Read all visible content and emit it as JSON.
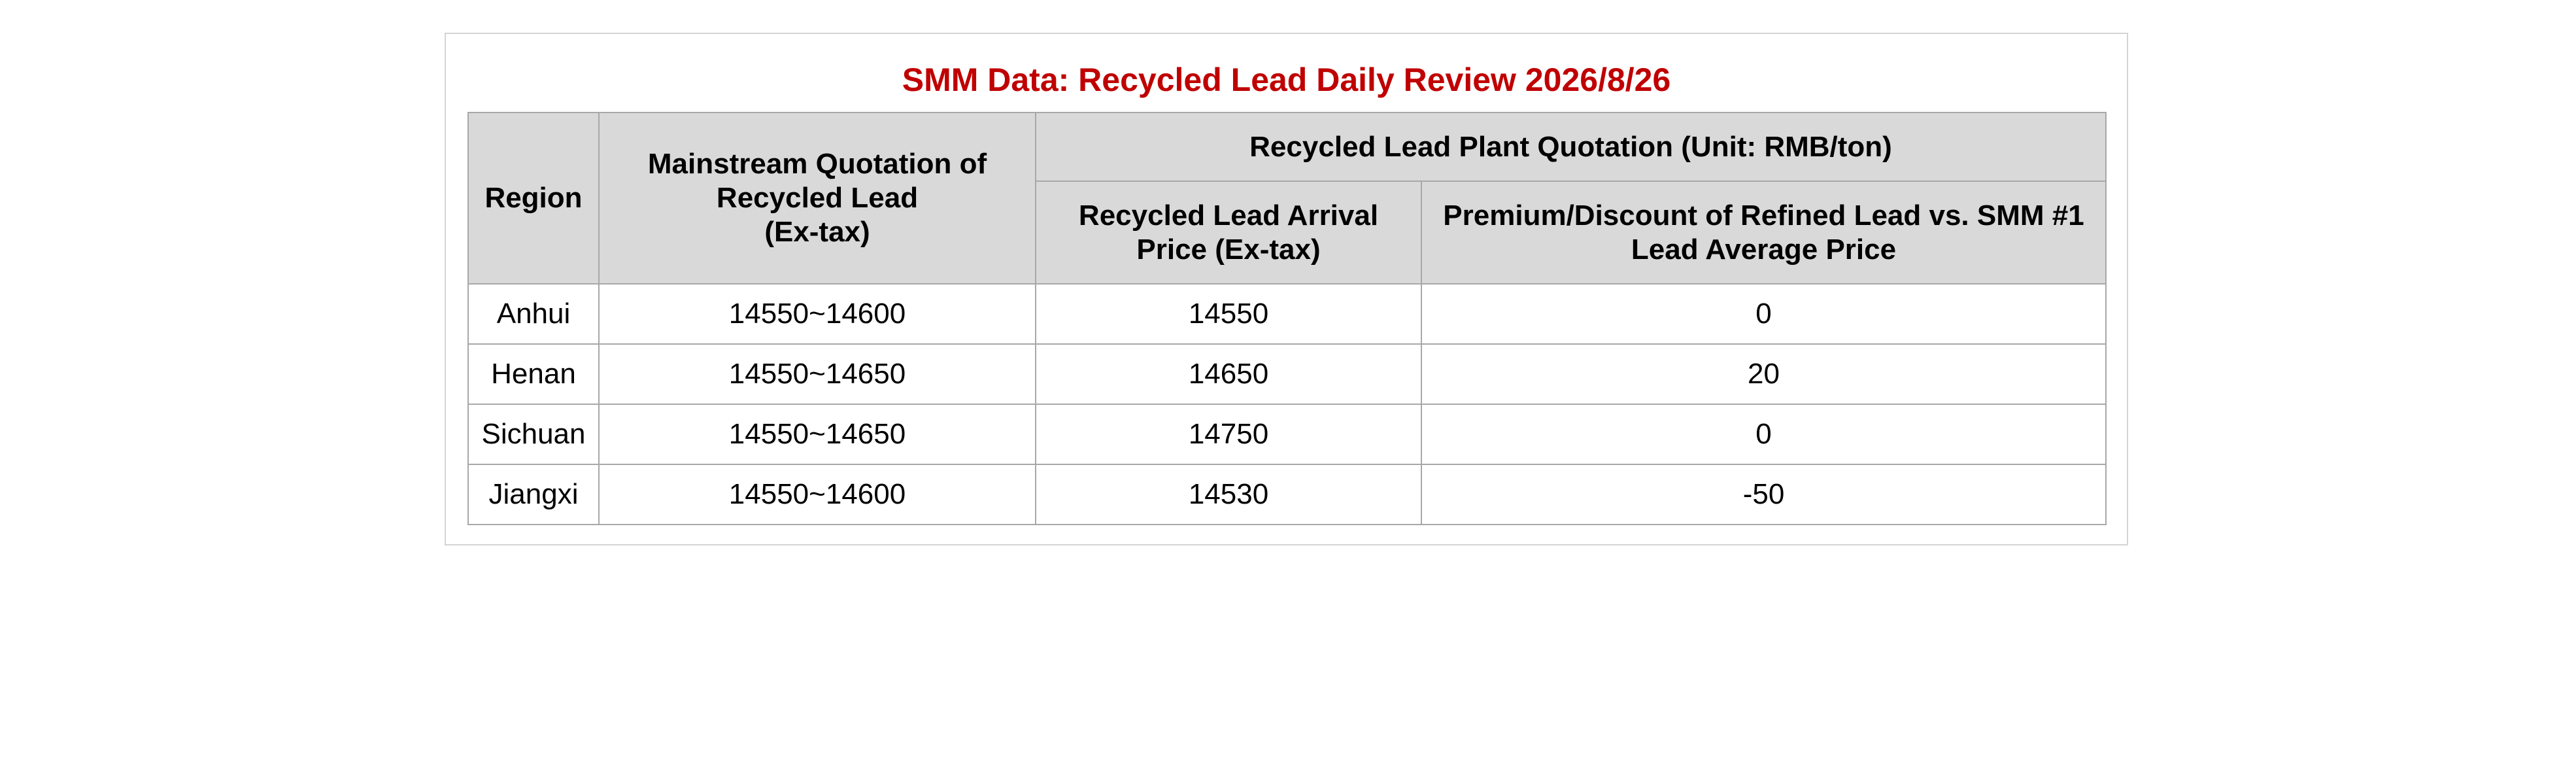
{
  "title": "SMM Data: Recycled Lead Daily Review 2026/8/26",
  "colors": {
    "title": "#c00000",
    "header_bg": "#d9d9d9",
    "border": "#a8a8a8"
  },
  "table": {
    "headers": {
      "region": "Region",
      "mainstream_line1": "Mainstream Quotation of",
      "mainstream_line2": "Recycled Lead",
      "mainstream_line3": "(Ex-tax)",
      "plant_group": "Recycled Lead Plant Quotation (Unit: RMB/ton)",
      "arrival_line1": "Recycled Lead Arrival",
      "arrival_line2": "Price (Ex-tax)",
      "premium_line1": "Premium/Discount of Refined Lead vs. SMM #1",
      "premium_line2": "Lead Average Price"
    },
    "rows": [
      {
        "region": "Anhui",
        "mainstream": "14550~14600",
        "arrival": "14550",
        "premium": "0"
      },
      {
        "region": "Henan",
        "mainstream": "14550~14650",
        "arrival": "14650",
        "premium": "20"
      },
      {
        "region": "Sichuan",
        "mainstream": "14550~14650",
        "arrival": "14750",
        "premium": "0"
      },
      {
        "region": "Jiangxi",
        "mainstream": "14550~14600",
        "arrival": "14530",
        "premium": "-50"
      }
    ]
  }
}
